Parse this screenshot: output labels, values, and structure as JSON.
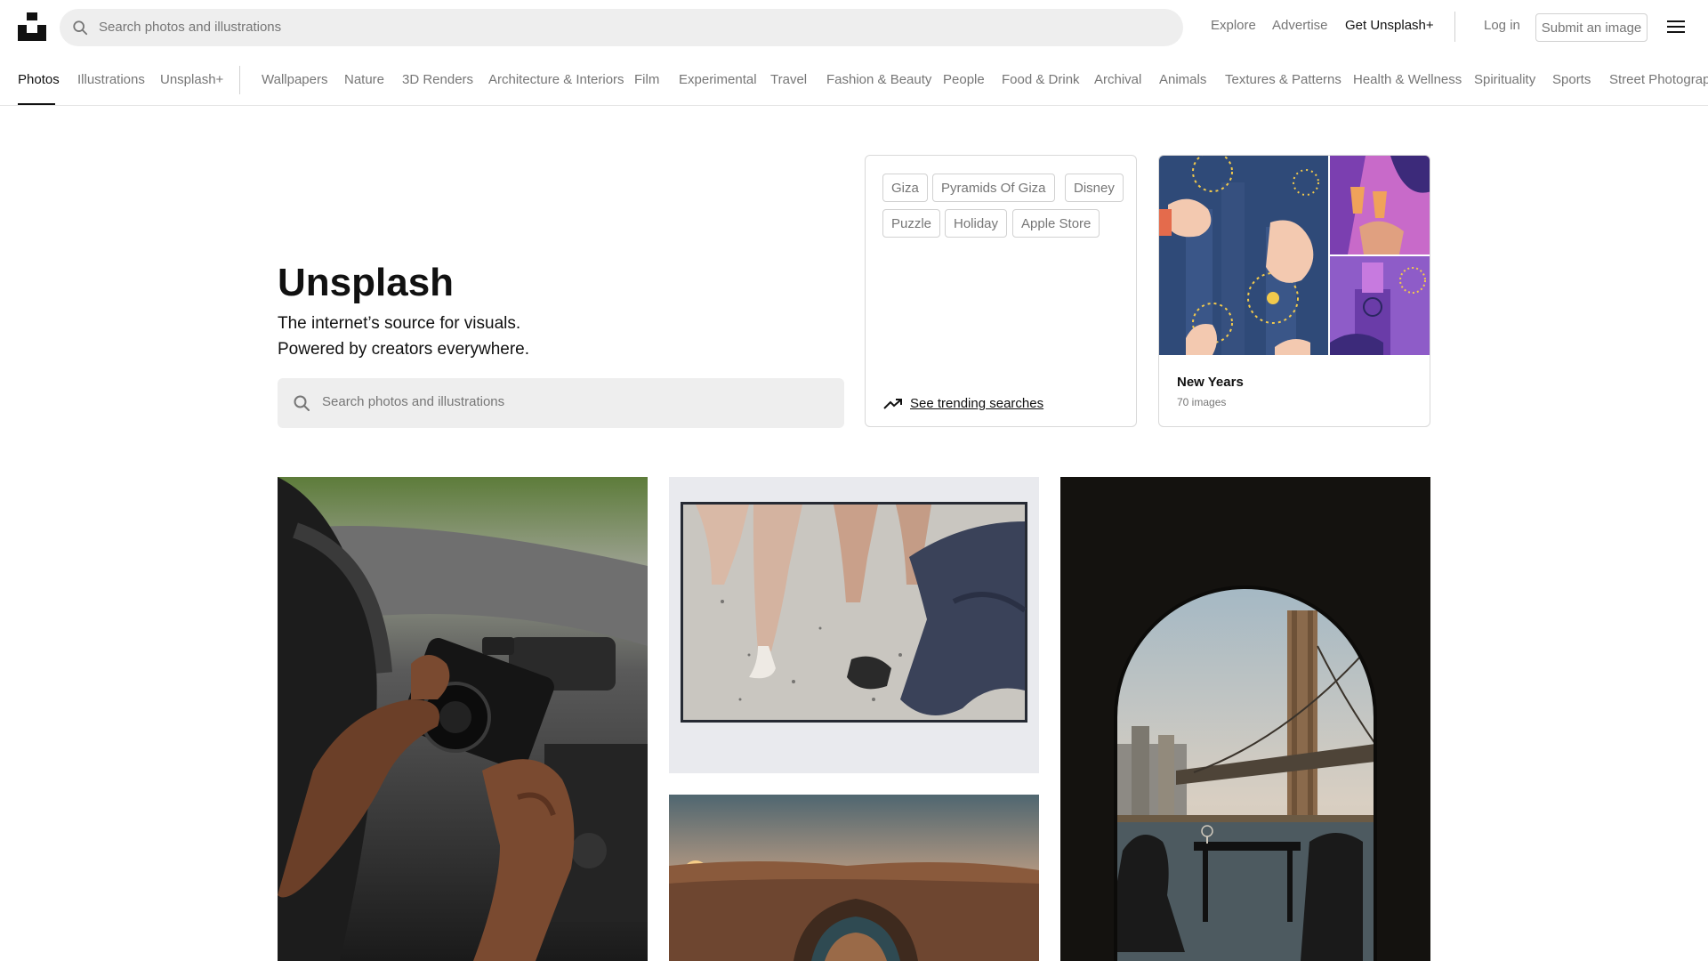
{
  "header": {
    "logo_icon": "unsplash-logo-icon",
    "search_placeholder": "Search photos and illustrations",
    "links": {
      "explore": "Explore",
      "advertise": "Advertise",
      "get_plus": "Get Unsplash+",
      "login": "Log in"
    },
    "submit_label": "Submit an image",
    "menu_icon": "hamburger-menu-icon"
  },
  "nav": {
    "categories": [
      "Photos",
      "Illustrations",
      "Unsplash+",
      "Wallpapers",
      "Nature",
      "3D Renders",
      "Architecture & Interiors",
      "Film",
      "Experimental",
      "Travel",
      "Fashion & Beauty",
      "People",
      "Food & Drink",
      "Archival",
      "Animals",
      "Textures & Patterns",
      "Health & Wellness",
      "Spirituality",
      "Sports",
      "Street Photography"
    ],
    "active": "Photos"
  },
  "hero": {
    "title": "Unsplash",
    "subtitle_line1": "The internet’s source for visuals.",
    "subtitle_line2": "Powered by creators everywhere.",
    "search_placeholder": "Search photos and illustrations"
  },
  "trending": {
    "chips": [
      "Giza",
      "Pyramids Of Giza",
      "Disney",
      "Puzzle",
      "Holiday",
      "Apple Store"
    ],
    "link_label": "See trending searches",
    "link_icon": "trending-up-icon"
  },
  "collection": {
    "title": "New Years",
    "count": "70 images"
  },
  "photos": [
    {
      "name": "photo-hands-holding-camera-in-car"
    },
    {
      "name": "photo-polaroid-legs-heels"
    },
    {
      "name": "photo-canyon-horseshoe-bend"
    },
    {
      "name": "photo-brooklyn-bridge-through-arch"
    }
  ],
  "colors": {
    "text": "#111111",
    "muted": "#767676",
    "border": "#d1d1d1",
    "search_bg": "#eeeeee"
  }
}
